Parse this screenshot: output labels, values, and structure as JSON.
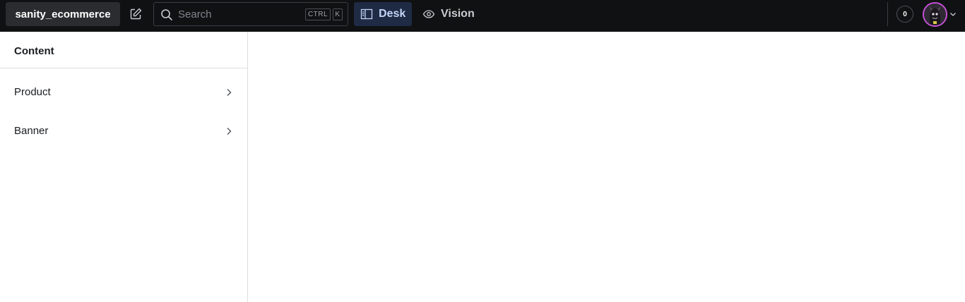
{
  "header": {
    "project_name": "sanity_ecommerce",
    "compose_icon": "compose-icon",
    "search": {
      "placeholder": "Search",
      "shortcut_ctrl": "CTRL",
      "shortcut_key": "K"
    },
    "tools": [
      {
        "label": "Desk",
        "icon": "desk-icon",
        "active": true
      },
      {
        "label": "Vision",
        "icon": "eye-icon",
        "active": false
      }
    ],
    "notifications_count": "0",
    "avatar_icon": "user-avatar",
    "colors": {
      "topbar_bg": "#101112",
      "active_tool_bg": "#1f2b45",
      "active_tool_text": "#c3d3f5",
      "avatar_ring": "#c650d8"
    }
  },
  "sidebar": {
    "title": "Content",
    "items": [
      {
        "label": "Product",
        "icon": "chevron-right-icon"
      },
      {
        "label": "Banner",
        "icon": "chevron-right-icon"
      }
    ]
  }
}
